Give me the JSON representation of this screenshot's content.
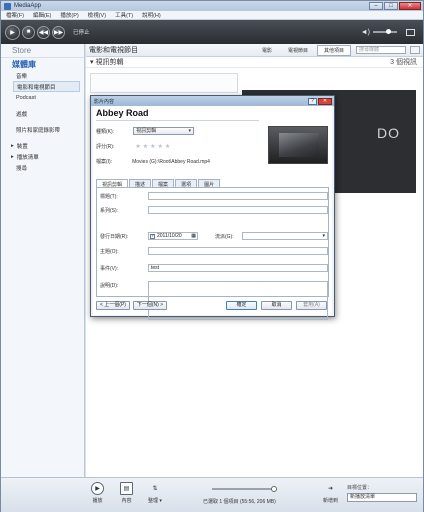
{
  "window": {
    "title": "MediaApp",
    "controls": [
      "–",
      "□",
      "✕"
    ]
  },
  "menu": [
    "檔案(F)",
    "編輯(E)",
    "播放(P)",
    "檢視(V)",
    "工具(T)",
    "說明(H)"
  ],
  "player": {
    "status": "已停止"
  },
  "sidebar": {
    "store": "Store",
    "library": "媒體庫",
    "items": [
      "音樂",
      "電影和電視節目",
      "Podcast",
      "遊戲",
      "照片和家庭錄影帶"
    ],
    "selected_index": 1,
    "groups": [
      "裝置",
      "播放清單",
      "搜尋"
    ]
  },
  "nav": {
    "breadcrumb": "電影和電視節目",
    "tabs": [
      "電影",
      "電視節目",
      "其他項目"
    ],
    "active_tab": 2,
    "search_placeholder": "搜尋媒體"
  },
  "subbar": {
    "category": "▾ 視訊剪輯",
    "count": "3 個視訊"
  },
  "thumb_text": "DO",
  "bottom": {
    "play": "播放",
    "info": "內容",
    "sort": "整理 ▾",
    "status": "已選取 1 個項目 (55:56, 206 MB)",
    "sync": "新增到",
    "target_label": "目標位置：",
    "target_value": "新播放清單"
  },
  "dialog": {
    "title": "影片內容",
    "heading": "Abbey Road",
    "kind_label": "種類(K):",
    "kind_value": "視訊剪輯",
    "rating_label": "評分(R):",
    "file_label": "檔案(I):",
    "file_value": "Movies (G):\\Root\\Abbey Road.mp4",
    "tabs": [
      "視訊剪輯",
      "描述",
      "檔案",
      "選項",
      "圖片"
    ],
    "active_tab": 0,
    "fields": {
      "title": "標題(T):",
      "series": "系列(S):",
      "release": "發行日期(R):",
      "date": "2011/10/20",
      "genre": "流派(G):",
      "subject": "主題(O):",
      "event": "事件(V):",
      "event_value": "test",
      "description": "說明(D):"
    },
    "buttons": {
      "prev": "< 上一個(P)",
      "next": "下一個(N) >",
      "ok": "確定",
      "cancel": "取消",
      "apply": "套用(A)"
    }
  }
}
